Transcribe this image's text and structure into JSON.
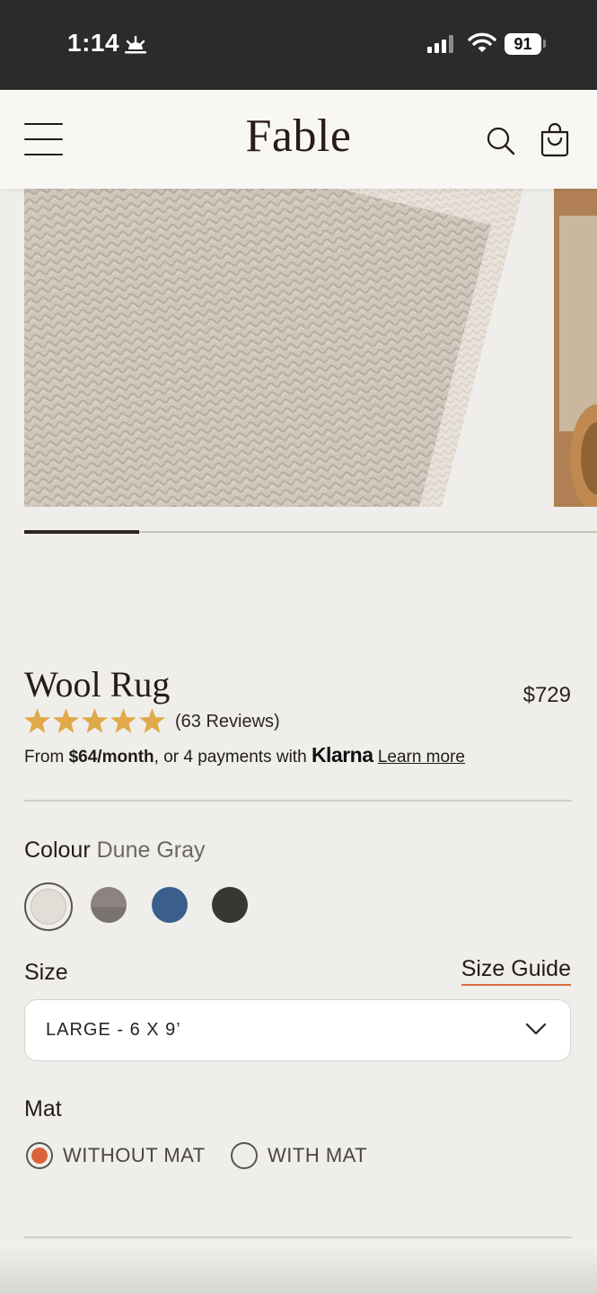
{
  "status_bar": {
    "time": "1:14",
    "battery": "91"
  },
  "header": {
    "logo": "Fable",
    "menu_icon": "menu-icon",
    "search_icon": "search-icon",
    "cart_icon": "shopping-bag-icon"
  },
  "gallery": {
    "current_slide_fraction": 0.2
  },
  "product": {
    "title": "Wool Rug",
    "price": "$729",
    "rating": 5,
    "reviews": "(63 Reviews)",
    "financing_prefix": "From ",
    "financing_amount": "$64/month",
    "financing_middle": ", or 4 payments with ",
    "financing_brand": "Klarna",
    "learn_more": "Learn more"
  },
  "colour": {
    "label": "Colour",
    "selected": "Dune Gray",
    "swatches": [
      {
        "name": "Dune Gray",
        "color": "#e3ddd8",
        "selected": true
      },
      {
        "name": "Taupe",
        "color": "#8d8482"
      },
      {
        "name": "Blue",
        "color": "#3a5f8c"
      },
      {
        "name": "Charcoal",
        "color": "#353833"
      }
    ]
  },
  "size": {
    "label": "Size",
    "guide": "Size Guide",
    "selected": "LARGE - 6 X 9’"
  },
  "mat": {
    "label": "Mat",
    "options": [
      {
        "label": "WITHOUT MAT",
        "selected": true
      },
      {
        "label": "WITH MAT",
        "selected": false
      }
    ]
  },
  "colors": {
    "accent": "#d9623b",
    "star": "#e0a94a"
  }
}
